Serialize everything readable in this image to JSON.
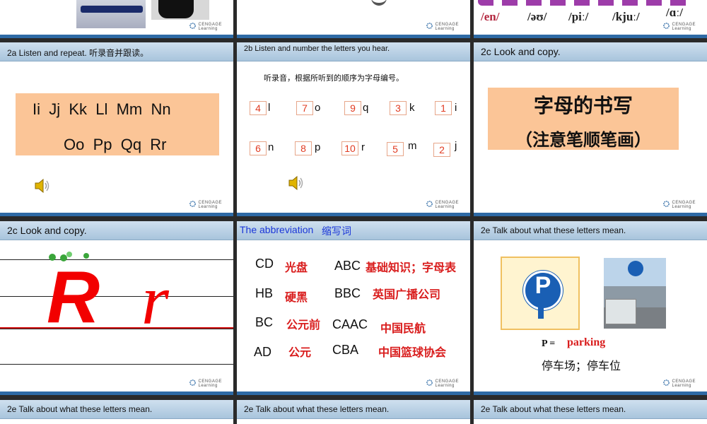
{
  "common": {
    "logo_line1": "CENGAGE",
    "logo_line2": "Learning"
  },
  "top_row": {
    "phonetics": [
      "/en/",
      "/əʊ/",
      "/piː/",
      "/kjuː/",
      "/ɑː/"
    ]
  },
  "slide_2a": {
    "header": "2a  Listen and repeat. 听录音并跟读。",
    "line1": "Ii  Jj  Kk  Ll  Mm  Nn",
    "line2": "Oo  Pp  Qq  Rr"
  },
  "slide_2b": {
    "header": "2b  Listen and number the letters you hear.",
    "instruction": "听录音，根据所听到的顺序为字母编号。",
    "row1": [
      {
        "num": "4",
        "letter": "l"
      },
      {
        "num": "7",
        "letter": "o"
      },
      {
        "num": "9",
        "letter": "q"
      },
      {
        "num": "3",
        "letter": "k"
      },
      {
        "num": "1",
        "letter": "i"
      }
    ],
    "row2": [
      {
        "num": "6",
        "letter": "n"
      },
      {
        "num": "8",
        "letter": "p"
      },
      {
        "num": "10",
        "letter": "r"
      },
      {
        "num": "5",
        "letter": "m"
      },
      {
        "num": "2",
        "letter": "j"
      }
    ]
  },
  "slide_2c_a": {
    "header": "2c  Look and copy.",
    "title": "字母的书写",
    "subtitle": "（注意笔顺笔画）"
  },
  "slide_2c_b": {
    "header": "2c  Look and copy.",
    "upper": "R",
    "lower": "r"
  },
  "slide_abbr": {
    "header_en": "The abbreviation",
    "header_cn": "缩写词",
    "items": [
      {
        "abbr": "CD",
        "meaning": "光盘"
      },
      {
        "abbr": "ABC",
        "meaning": "基础知识；字母表"
      },
      {
        "abbr": "HB",
        "meaning": "硬黑"
      },
      {
        "abbr": "BBC",
        "meaning": "英国广播公司"
      },
      {
        "abbr": "BC",
        "meaning": "公元前"
      },
      {
        "abbr": "CAAC",
        "meaning": "中国民航"
      },
      {
        "abbr": "AD",
        "meaning": "公元"
      },
      {
        "abbr": "CBA",
        "meaning": "中国篮球协会"
      }
    ]
  },
  "slide_2e": {
    "header": "2e  Talk about what these letters mean.",
    "sign_letter": "P",
    "p_label": "P =",
    "p_meaning": "parking",
    "p_cn": "停车场；停车位"
  },
  "bottom_row": {
    "headers": [
      "2e  Talk about what these letters mean.",
      "2e  Talk about what these letters mean.",
      "2e  Talk about what these letters mean."
    ]
  }
}
